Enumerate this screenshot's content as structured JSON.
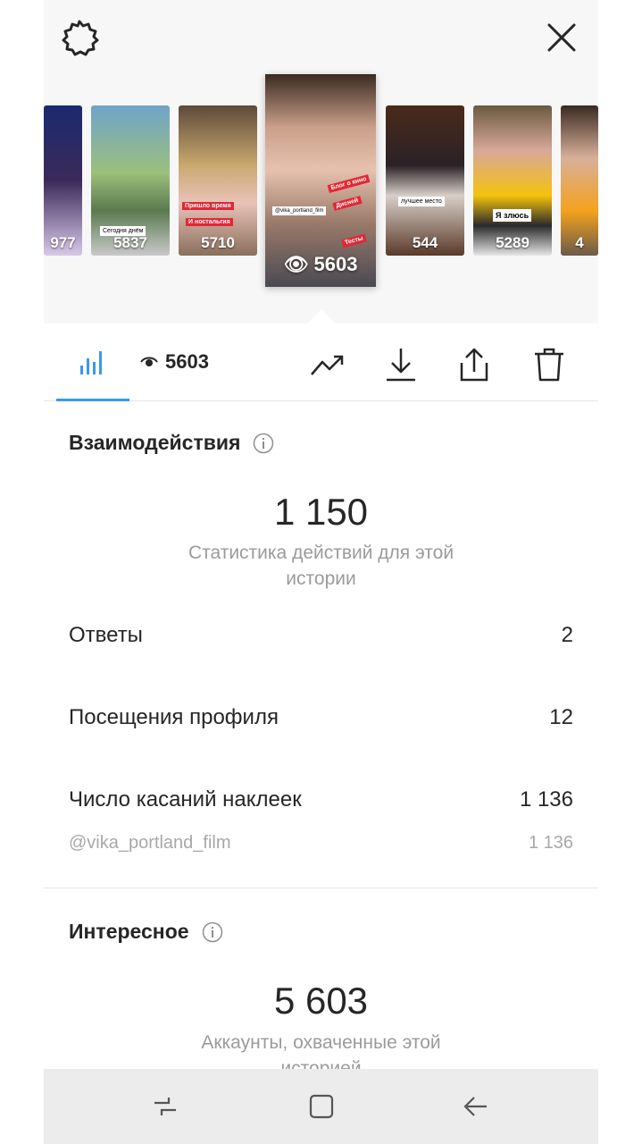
{
  "header": {
    "settings_icon": "gear-icon",
    "close_icon": "close-icon"
  },
  "stories": {
    "items": [
      {
        "views": "977"
      },
      {
        "views": "5837",
        "caption": "Сегодня днём"
      },
      {
        "views": "5710",
        "sticker1": "Пришло время",
        "sticker2": "И ностальгия"
      },
      {
        "views": "544",
        "caption": "лучшее место"
      },
      {
        "views": "5289",
        "sticker1": "Я злюсь"
      },
      {
        "views": "4"
      }
    ],
    "selected": {
      "views": "5603",
      "stickers": [
        "Блог о кино",
        "Дисней",
        "Тесты",
        "@vika_portland_film"
      ]
    }
  },
  "tabs": {
    "stats_icon": "bar-chart-icon",
    "views_icon": "eye-icon",
    "views_count": "5603",
    "actions": [
      "trend-icon",
      "download-icon",
      "share-icon",
      "trash-icon"
    ]
  },
  "interactions": {
    "title": "Взаимодействия",
    "total": "1 150",
    "subtitle": "Статистика действий для этой истории",
    "rows": [
      {
        "label": "Ответы",
        "value": "2"
      },
      {
        "label": "Посещения профиля",
        "value": "12"
      },
      {
        "label": "Число касаний наклеек",
        "value": "1 136"
      }
    ],
    "sub_row": {
      "label": "@vika_portland_film",
      "value": "1 136"
    }
  },
  "discovery": {
    "title": "Интересное",
    "total": "5 603",
    "subtitle": "Аккаунты, охваченные этой историей"
  },
  "navbar": {
    "icons": [
      "recent-apps-icon",
      "home-icon",
      "back-icon"
    ]
  }
}
